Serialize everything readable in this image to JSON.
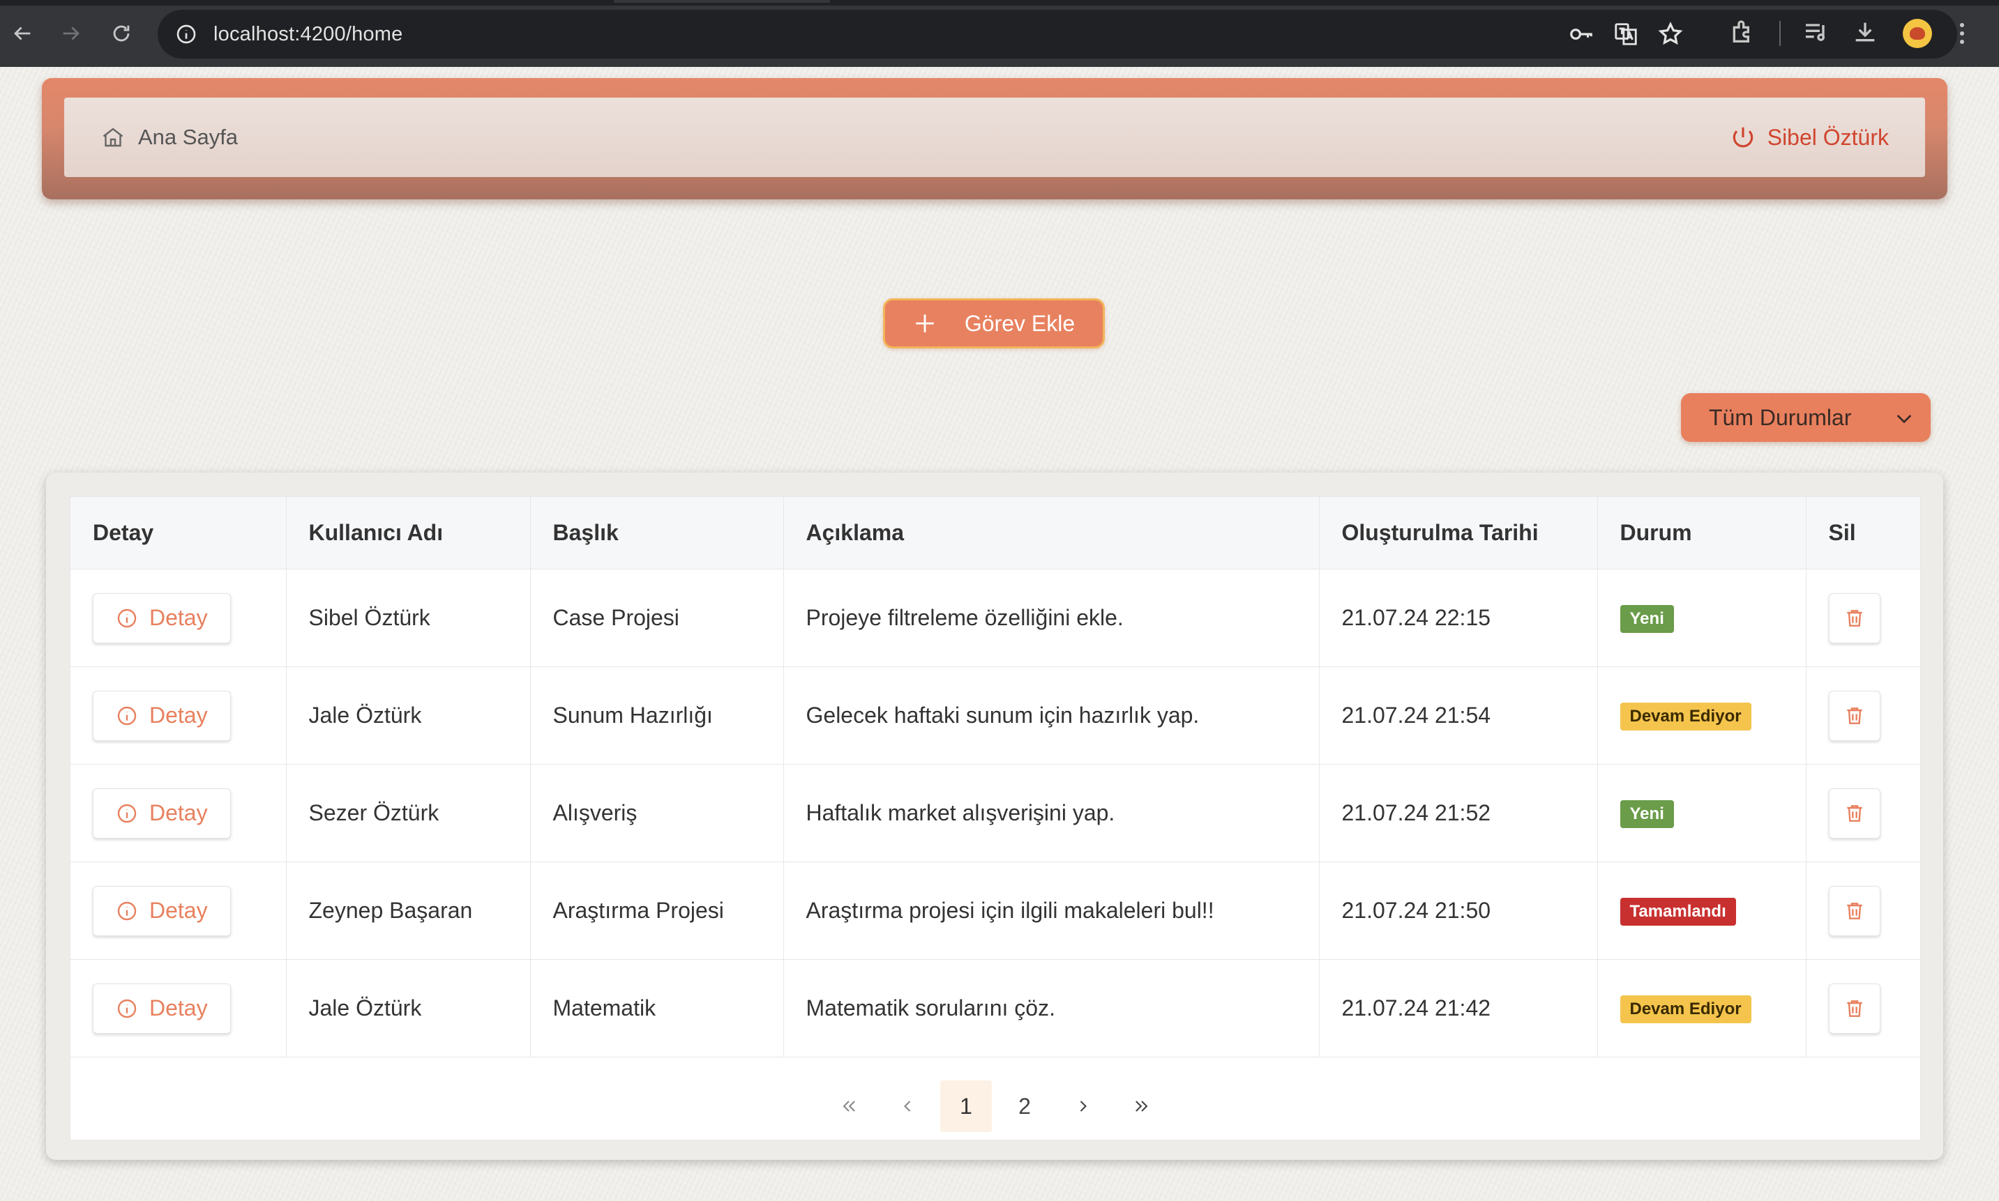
{
  "browser": {
    "url": "localhost:4200/home"
  },
  "header": {
    "home_label": "Ana Sayfa",
    "user_name": "Sibel Öztürk"
  },
  "actions": {
    "add_task_label": "Görev Ekle"
  },
  "filter": {
    "selected": "Tüm Durumlar"
  },
  "table": {
    "columns": {
      "detail": "Detay",
      "username": "Kullanıcı Adı",
      "title": "Başlık",
      "description": "Açıklama",
      "created": "Oluşturulma Tarihi",
      "status": "Durum",
      "delete": "Sil"
    },
    "detail_button_label": "Detay",
    "rows": [
      {
        "username": "Sibel Öztürk",
        "title": "Case Projesi",
        "description": "Projeye filtreleme özelliğini ekle.",
        "created": "21.07.24 22:15",
        "status": "Yeni"
      },
      {
        "username": "Jale Öztürk",
        "title": "Sunum Hazırlığı",
        "description": "Gelecek haftaki sunum için hazırlık yap.",
        "created": "21.07.24 21:54",
        "status": "Devam Ediyor"
      },
      {
        "username": "Sezer Öztürk",
        "title": "Alışveriş",
        "description": "Haftalık market alışverişini yap.",
        "created": "21.07.24 21:52",
        "status": "Yeni"
      },
      {
        "username": "Zeynep Başaran",
        "title": "Araştırma Projesi",
        "description": "Araştırma projesi için ilgili makaleleri bul!!",
        "created": "21.07.24 21:50",
        "status": "Tamamlandı"
      },
      {
        "username": "Jale Öztürk",
        "title": "Matematik",
        "description": "Matematik sorularını çöz.",
        "created": "21.07.24 21:42",
        "status": "Devam Ediyor"
      }
    ]
  },
  "pagination": {
    "pages": [
      "1",
      "2"
    ],
    "current": "1"
  },
  "colors": {
    "accent": "#e8805e",
    "status_new": "#6a9c49",
    "status_in_progress": "#f4c44c",
    "status_done": "#c8302f"
  }
}
